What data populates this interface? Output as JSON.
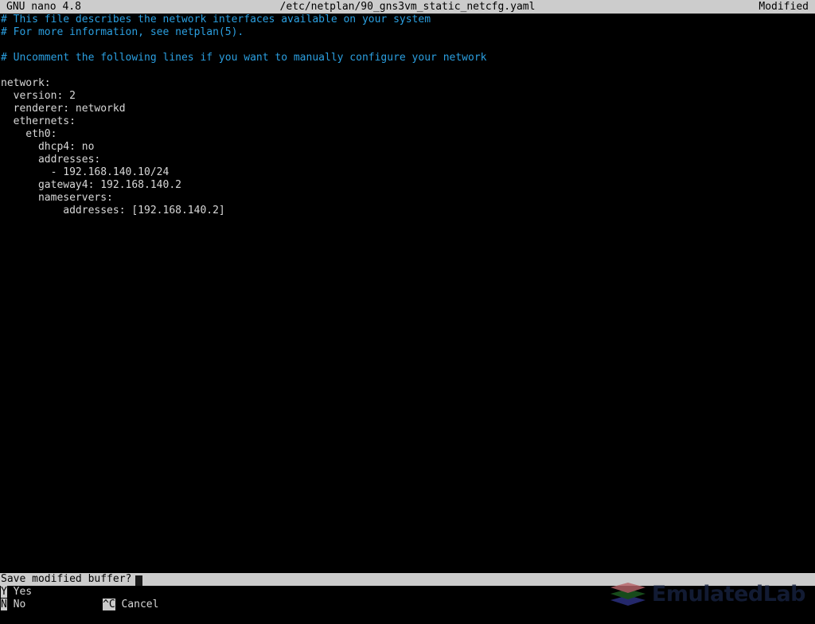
{
  "titlebar": {
    "version": "GNU nano 4.8",
    "filename": "/etc/netplan/90_gns3vm_static_netcfg.yaml",
    "status": "Modified"
  },
  "editor": {
    "lines": [
      {
        "text": "# This file describes the network interfaces available on your system",
        "type": "comment"
      },
      {
        "text": "# For more information, see netplan(5).",
        "type": "comment"
      },
      {
        "text": "",
        "type": "blank"
      },
      {
        "text": "# Uncomment the following lines if you want to manually configure your network",
        "type": "comment"
      },
      {
        "text": "",
        "type": "blank"
      },
      {
        "text": "network:",
        "type": "text"
      },
      {
        "text": "  version: 2",
        "type": "text"
      },
      {
        "text": "  renderer: networkd",
        "type": "text"
      },
      {
        "text": "  ethernets:",
        "type": "text"
      },
      {
        "text": "    eth0:",
        "type": "text"
      },
      {
        "text": "      dhcp4: no",
        "type": "text"
      },
      {
        "text": "      addresses:",
        "type": "text"
      },
      {
        "text": "        - 192.168.140.10/24",
        "type": "text"
      },
      {
        "text": "      gateway4: 192.168.140.2",
        "type": "text"
      },
      {
        "text": "      nameservers:",
        "type": "text"
      },
      {
        "text": "          addresses: [192.168.140.2]",
        "type": "text"
      }
    ]
  },
  "prompt": {
    "question": "Save modified buffer? "
  },
  "shortcuts": {
    "row1": [
      {
        "key": "Y",
        "label": " Yes"
      }
    ],
    "row2": [
      {
        "key": "N",
        "label": " No"
      },
      {
        "key": "^C",
        "label": " Cancel"
      }
    ]
  },
  "watermark": {
    "brand": "EmulatedLab",
    "layer_colors": {
      "top": "#b8656a",
      "middle": "#1d5c22",
      "bottom": "#2c3183"
    }
  },
  "colors": {
    "background": "#000000",
    "foreground": "#d8d8d8",
    "comment": "#2b9fe0",
    "bar_background": "#cccccc",
    "bar_foreground": "#000000"
  }
}
